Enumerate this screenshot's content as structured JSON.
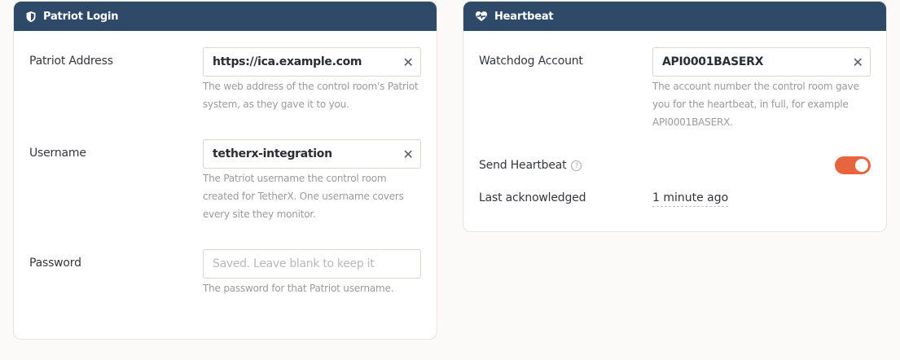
{
  "patriot": {
    "title": "Patriot Login",
    "address_label": "Patriot Address",
    "address_value": "https://ica.example.com",
    "address_help_1": "The web address of the control room's Patriot",
    "address_help_2": "system, as they gave it to you.",
    "username_label": "Username",
    "username_value": "tetherx-integration",
    "username_help_1": "The Patriot username the control room",
    "username_help_2": "created for TetherX. One username covers",
    "username_help_3": "every site they monitor.",
    "password_label": "Password",
    "password_placeholder": "Saved. Leave blank to keep it",
    "password_help": "The password for that Patriot username."
  },
  "heartbeat": {
    "title": "Heartbeat",
    "account_label": "Watchdog Account",
    "account_value": "API0001BASERX",
    "account_help_1": "The account number the control room gave",
    "account_help_2": "you for the heartbeat, in full, for example",
    "account_help_3": "API0001BASERX.",
    "send_label": "Send Heartbeat",
    "send_enabled": true,
    "last_ack_label": "Last acknowledged",
    "last_ack_value": "1 minute ago"
  },
  "clear_glyph": "✕",
  "info_glyph": "?",
  "colors": {
    "header": "#2f4a68",
    "toggle_on": "#e8643f"
  },
  "icons": {
    "patriot": "shield-icon",
    "heartbeat": "heart-pulse-icon",
    "clear": "close-icon",
    "info": "info-circle-icon"
  }
}
